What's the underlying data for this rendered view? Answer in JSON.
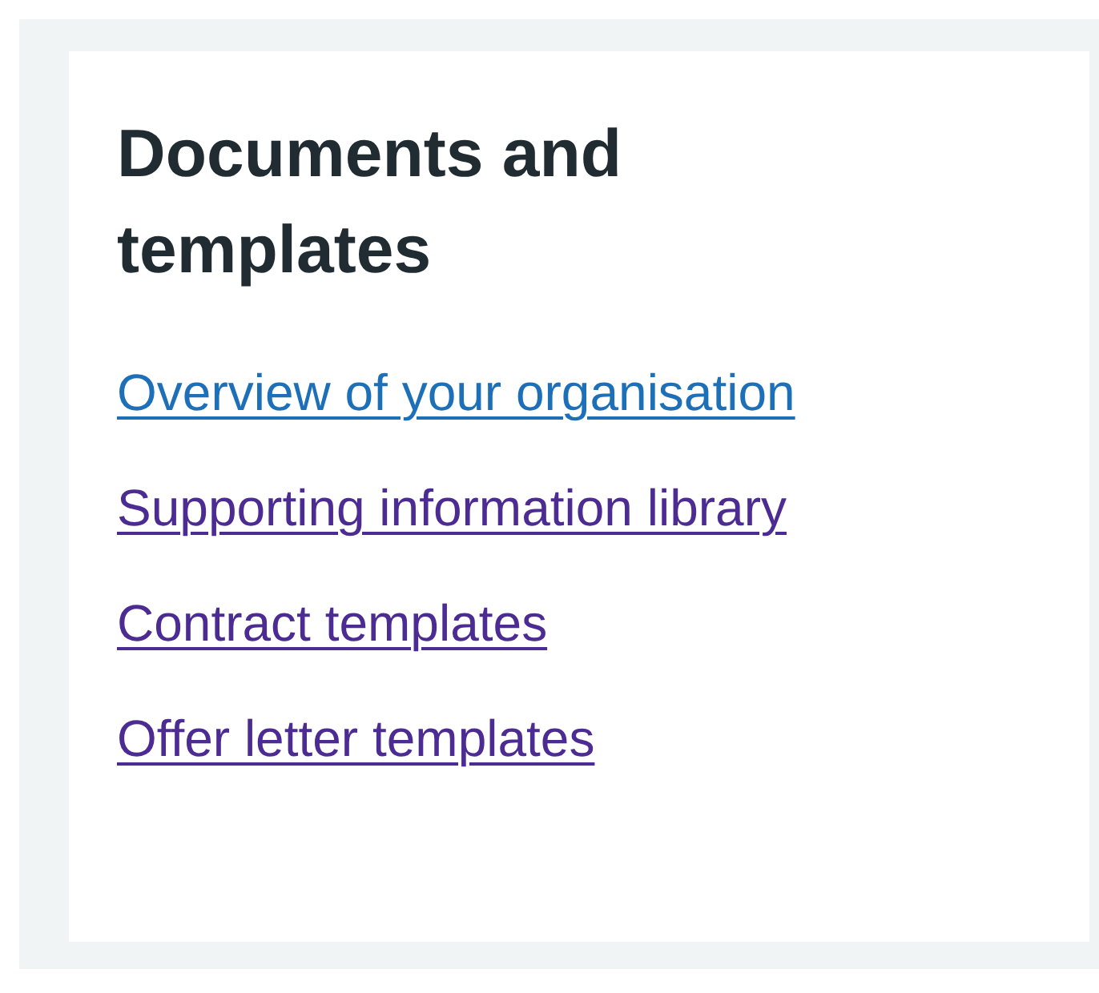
{
  "panel": {
    "title": "Documents and templates",
    "links": [
      {
        "label": "Overview of your organisation",
        "visited": false
      },
      {
        "label": "Supporting information library",
        "visited": true
      },
      {
        "label": "Contract templates",
        "visited": true
      },
      {
        "label": "Offer letter templates",
        "visited": true
      }
    ]
  }
}
